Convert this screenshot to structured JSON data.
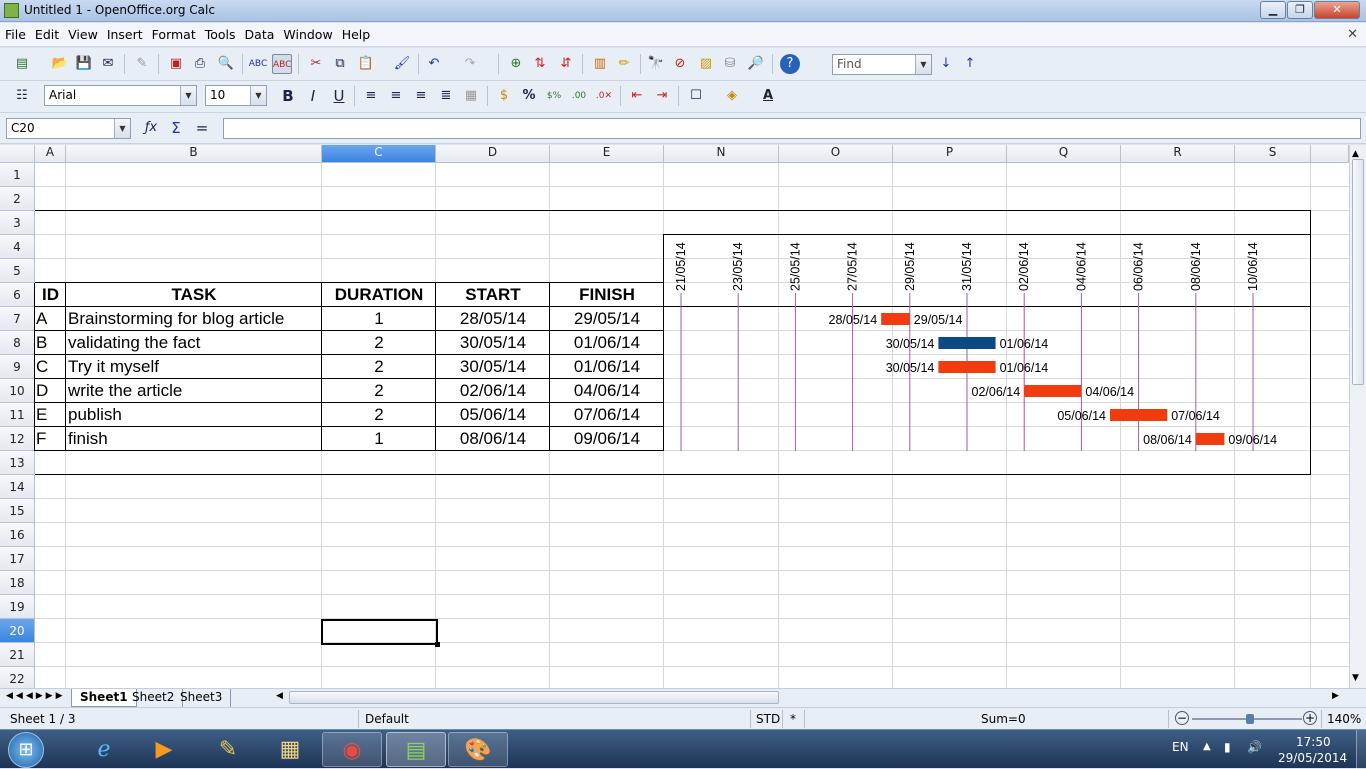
{
  "window": {
    "title": "Untitled 1 - OpenOffice.org Calc",
    "btn_min": "▁",
    "btn_max": "❐",
    "btn_close": "✕"
  },
  "menu": [
    "File",
    "Edit",
    "View",
    "Insert",
    "Format",
    "Tools",
    "Data",
    "Window",
    "Help"
  ],
  "toolbar": {
    "find_placeholder": "Find",
    "font_name": "Arial",
    "font_size": "10",
    "bold": "B",
    "italic": "I",
    "underline": "U",
    "percent": "%"
  },
  "formula": {
    "cell_ref": "C20",
    "equals": "=",
    "content": ""
  },
  "columns": [
    "A",
    "B",
    "C",
    "D",
    "E",
    "N",
    "O",
    "P",
    "Q",
    "R",
    "S"
  ],
  "rows": [
    "1",
    "2",
    "3",
    "4",
    "5",
    "6",
    "7",
    "8",
    "9",
    "10",
    "11",
    "12",
    "13",
    "14",
    "15",
    "16",
    "17",
    "18",
    "19",
    "20",
    "21",
    "22"
  ],
  "selected": {
    "column": "C",
    "row": "20"
  },
  "table": {
    "headers": [
      "ID",
      "TASK",
      "DURATION",
      "START",
      "FINISH"
    ],
    "tasks": [
      {
        "id": "A",
        "task": "Brainstorming for blog article",
        "duration": "1",
        "start": "28/05/14",
        "finish": "29/05/14"
      },
      {
        "id": "B",
        "task": "validating the fact",
        "duration": "2",
        "start": "30/05/14",
        "finish": "01/06/14"
      },
      {
        "id": "C",
        "task": "Try it myself",
        "duration": "2",
        "start": "30/05/14",
        "finish": "01/06/14"
      },
      {
        "id": "D",
        "task": "write the article",
        "duration": "2",
        "start": "02/06/14",
        "finish": "04/06/14"
      },
      {
        "id": "E",
        "task": "publish",
        "duration": "2",
        "start": "05/06/14",
        "finish": "07/06/14"
      },
      {
        "id": "F",
        "task": "finish",
        "duration": "1",
        "start": "08/06/14",
        "finish": "09/06/14"
      }
    ]
  },
  "chart_data": {
    "type": "bar",
    "orientation": "gantt",
    "x_axis_ticks": [
      "21/05/14",
      "23/05/14",
      "25/05/14",
      "27/05/14",
      "29/05/14",
      "31/05/14",
      "02/06/14",
      "04/06/14",
      "06/06/14",
      "08/06/14",
      "10/06/14"
    ],
    "xlim": [
      "2014-05-21",
      "2014-06-11"
    ],
    "grid": true,
    "bars": [
      {
        "start": "28/05/14",
        "finish": "29/05/14",
        "start_date": "2014-05-28",
        "finish_date": "2014-05-29",
        "color": "#f03c0f"
      },
      {
        "start": "30/05/14",
        "finish": "01/06/14",
        "start_date": "2014-05-30",
        "finish_date": "2014-06-01",
        "color": "#0d4a85"
      },
      {
        "start": "30/05/14",
        "finish": "01/06/14",
        "start_date": "2014-05-30",
        "finish_date": "2014-06-01",
        "color": "#f03c0f"
      },
      {
        "start": "02/06/14",
        "finish": "04/06/14",
        "start_date": "2014-06-02",
        "finish_date": "2014-06-04",
        "color": "#f03c0f"
      },
      {
        "start": "05/06/14",
        "finish": "07/06/14",
        "start_date": "2014-06-05",
        "finish_date": "2014-06-07",
        "color": "#f03c0f"
      },
      {
        "start": "08/06/14",
        "finish": "09/06/14",
        "start_date": "2014-06-08",
        "finish_date": "2014-06-09",
        "color": "#f03c0f"
      }
    ]
  },
  "sheets": [
    "Sheet1",
    "Sheet2",
    "Sheet3"
  ],
  "active_sheet": "Sheet1",
  "status": {
    "sheet": "Sheet 1 / 3",
    "style": "Default",
    "mode": "STD",
    "modified": "*",
    "sum": "Sum=0",
    "zoom": "140%"
  },
  "taskbar": {
    "lang": "EN",
    "time": "17:50",
    "date": "29/05/2014"
  }
}
